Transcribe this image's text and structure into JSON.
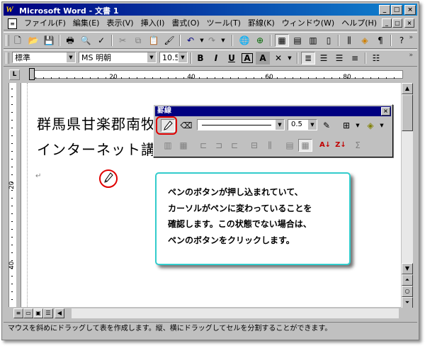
{
  "window": {
    "title": "Microsoft Word - 文書 1",
    "minimize": "_",
    "maximize": "□",
    "close": "×"
  },
  "menu": {
    "items": [
      "ファイル(F)",
      "編集(E)",
      "表示(V)",
      "挿入(I)",
      "書式(O)",
      "ツール(T)",
      "罫線(K)",
      "ウィンドウ(W)",
      "ヘルプ(H)"
    ]
  },
  "format_bar": {
    "style": "標準",
    "font": "MS 明朝",
    "size": "10.5",
    "bold": "B",
    "italic": "I",
    "underline": "U",
    "char_border": "A",
    "char_shading": "A"
  },
  "ruler": {
    "tab_selector": "L",
    "labels": [
      "20",
      "40",
      "60",
      "80"
    ]
  },
  "vertical_ruler": {
    "labels": [
      "20",
      "40"
    ]
  },
  "document": {
    "line1": "群馬県甘楽郡南牧",
    "line2": "インターネット講",
    "paragraph_mark": "↵"
  },
  "palette": {
    "title": "罫線",
    "close": "×",
    "line_weight": "0.5"
  },
  "callout": {
    "lines": [
      "ペンのボタンが押し込まれていて、",
      "カーソルがペンに変わっていることを",
      "確認します。この状態でない場合は、",
      "ペンのボタンをクリックします。"
    ]
  },
  "status_bar": {
    "text": "マウスを斜めにドラッグして表を作成します。縦、横にドラッグしてセルを分割することができます。"
  },
  "colors": {
    "titlebar": "#000080",
    "callout_border": "#33cccc",
    "highlight_ring": "#e00000"
  }
}
